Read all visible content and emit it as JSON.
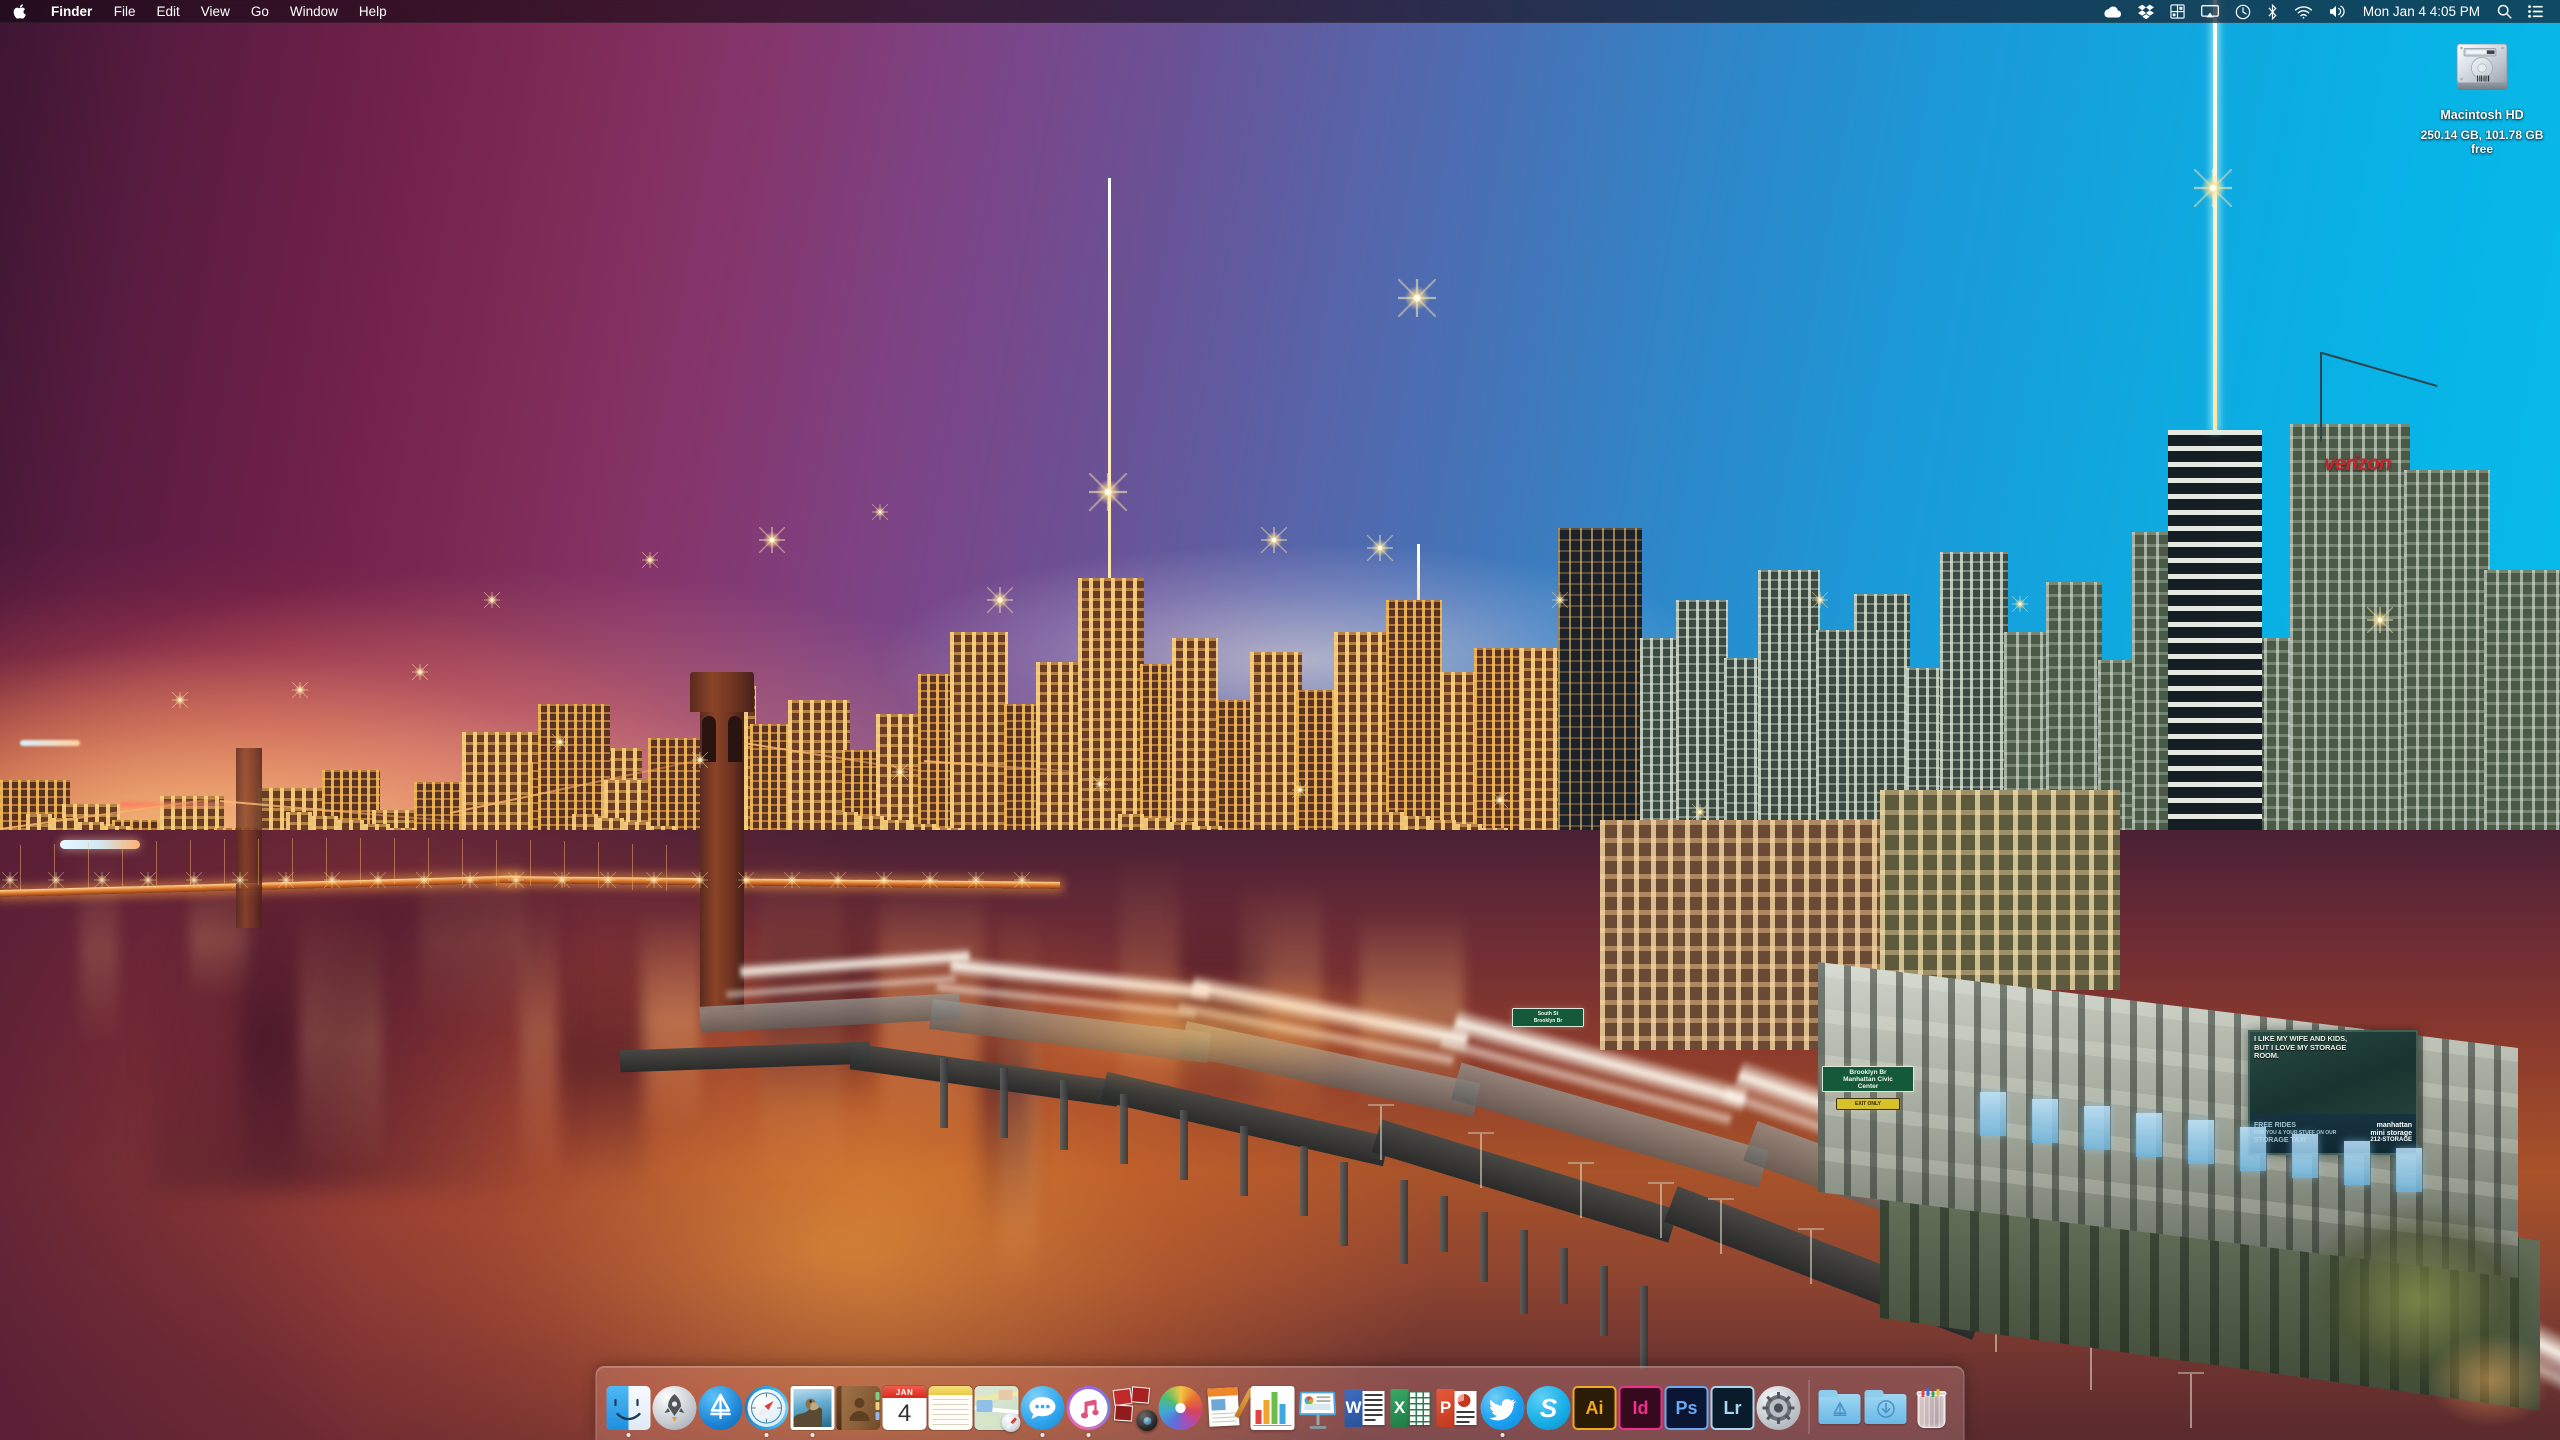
{
  "menubar": {
    "apple_icon": "apple-logo-icon",
    "app_name": "Finder",
    "items": [
      "File",
      "Edit",
      "View",
      "Go",
      "Window",
      "Help"
    ],
    "status_icons": [
      "cloud-icon",
      "dropbox-icon",
      "extension-grid-icon",
      "airplay-icon",
      "time-machine-icon",
      "bluetooth-icon",
      "wifi-icon",
      "volume-icon"
    ],
    "clock": "Mon Jan 4  4:05 PM",
    "search_icon": "search-icon",
    "notification_center_icon": "notification-center-icon"
  },
  "desktop": {
    "icons": [
      {
        "name": "Macintosh HD",
        "subtitle": "250.14 GB, 101.78 GB free",
        "icon": "hard-drive-icon"
      }
    ]
  },
  "wallpaper": {
    "scene": "New York City skyline at dusk with Brooklyn Bridge and East River",
    "sky_left_color": "#5a1c42",
    "sky_right_color": "#07bbea",
    "water_color": "#a9532a",
    "signs": [
      {
        "text": "Brooklyn Br\nManhattan Civic\nCenter",
        "color": "#14593a"
      },
      {
        "text": "EXIT ONLY",
        "color": "#d8c229"
      }
    ],
    "billboard": {
      "headline": "I LIKE MY WIFE AND KIDS, BUT I LOVE MY STORAGE ROOM.",
      "promo_line1": "FREE RIDES",
      "promo_line2": "FOR YOU & YOUR STUFF ON OUR",
      "promo_line3": "STORAGE TAXI",
      "brand_line1": "manhattan",
      "brand_line2": "mini storage",
      "brand_phone": "212-STORAGE"
    },
    "building_logo": "verizon"
  },
  "dock": {
    "items": [
      {
        "label": "Finder",
        "icon": "finder-icon",
        "running": true
      },
      {
        "label": "Launchpad",
        "icon": "launchpad-icon",
        "running": false
      },
      {
        "label": "App Store",
        "icon": "app-store-icon",
        "running": false
      },
      {
        "label": "Safari",
        "icon": "safari-icon",
        "running": true
      },
      {
        "label": "Mail",
        "icon": "mail-icon",
        "running": true
      },
      {
        "label": "Contacts",
        "icon": "contacts-icon",
        "running": false
      },
      {
        "label": "Calendar",
        "icon": "calendar-icon",
        "running": false,
        "month": "JAN",
        "day": "4"
      },
      {
        "label": "Notes",
        "icon": "notes-icon",
        "running": false
      },
      {
        "label": "Maps",
        "icon": "maps-icon",
        "running": false
      },
      {
        "label": "Messages",
        "icon": "messages-icon",
        "running": true
      },
      {
        "label": "iTunes",
        "icon": "itunes-icon",
        "running": true
      },
      {
        "label": "Photo Booth",
        "icon": "photo-booth-icon",
        "running": false
      },
      {
        "label": "Photos",
        "icon": "photos-icon",
        "running": false
      },
      {
        "label": "Pages",
        "icon": "pages-icon",
        "running": false
      },
      {
        "label": "Numbers",
        "icon": "numbers-icon",
        "running": false
      },
      {
        "label": "Keynote",
        "icon": "keynote-icon",
        "running": false
      },
      {
        "label": "Microsoft Word",
        "icon": "word-icon",
        "running": false,
        "letter": "W"
      },
      {
        "label": "Microsoft Excel",
        "icon": "excel-icon",
        "running": false,
        "letter": "X"
      },
      {
        "label": "Microsoft PowerPoint",
        "icon": "powerpoint-icon",
        "running": false,
        "letter": "P"
      },
      {
        "label": "Twitter",
        "icon": "twitter-icon",
        "running": true
      },
      {
        "label": "Skype",
        "icon": "skype-icon",
        "running": false,
        "letter": "S"
      },
      {
        "label": "Adobe Illustrator",
        "icon": "illustrator-icon",
        "running": false,
        "letter": "Ai"
      },
      {
        "label": "Adobe InDesign",
        "icon": "indesign-icon",
        "running": false,
        "letter": "Id"
      },
      {
        "label": "Adobe Photoshop",
        "icon": "photoshop-icon",
        "running": false,
        "letter": "Ps"
      },
      {
        "label": "Adobe Lightroom",
        "icon": "lightroom-icon",
        "running": false,
        "letter": "Lr"
      },
      {
        "label": "System Preferences",
        "icon": "system-preferences-icon",
        "running": false
      }
    ],
    "stacks": [
      {
        "label": "Applications",
        "icon": "applications-folder-icon"
      },
      {
        "label": "Downloads",
        "icon": "downloads-folder-icon"
      }
    ],
    "trash": {
      "label": "Trash",
      "icon": "trash-icon"
    }
  }
}
